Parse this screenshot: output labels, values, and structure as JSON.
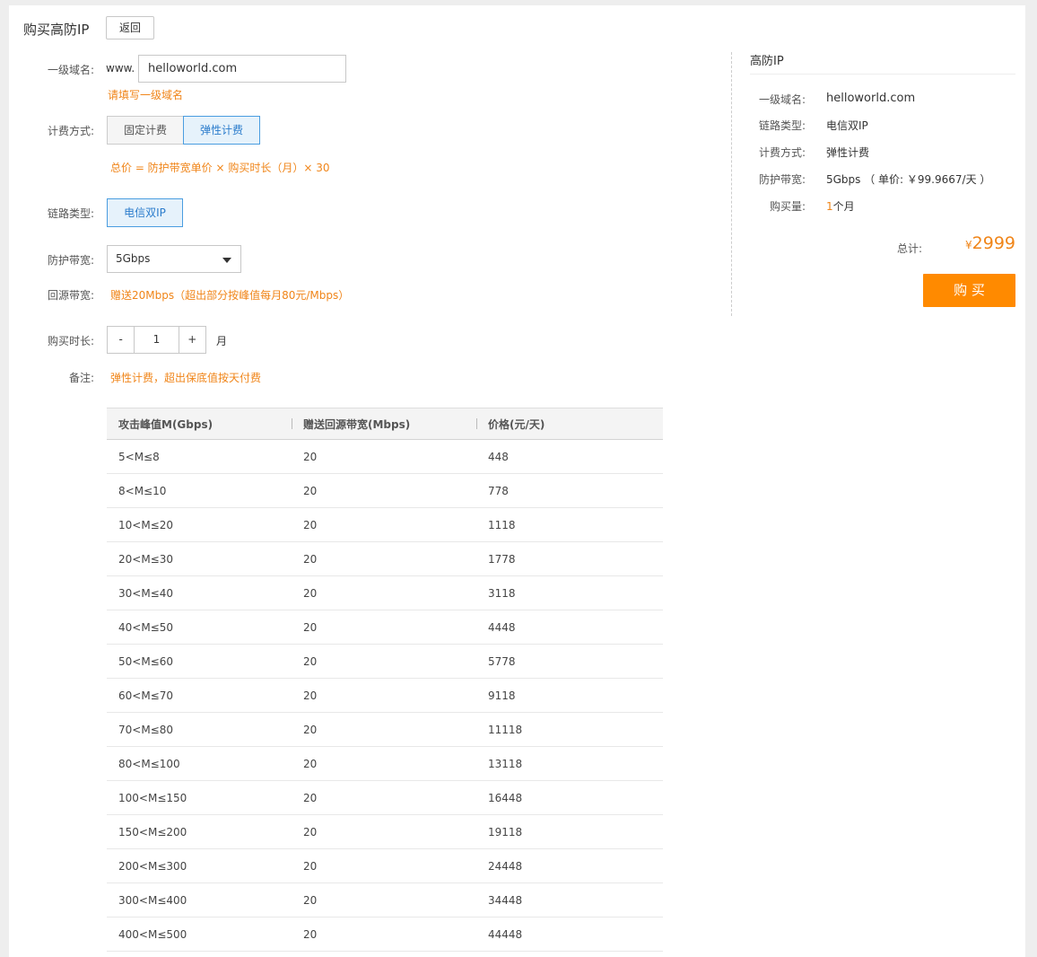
{
  "header": {
    "title": "购买高防IP",
    "back_label": "返回"
  },
  "form": {
    "domain": {
      "label": "一级域名:",
      "prefix": "www.",
      "value": "helloworld.com",
      "hint": "请填写一级域名"
    },
    "billing": {
      "label": "计费方式:",
      "options": [
        "固定计费",
        "弹性计费"
      ],
      "selected": "弹性计费",
      "formula": "总价 = 防护带宽单价 × 购买时长（月）× 30"
    },
    "line": {
      "label": "链路类型:",
      "options": [
        "电信双IP"
      ],
      "selected": "电信双IP"
    },
    "bandwidth": {
      "label": "防护带宽:",
      "selected": "5Gbps"
    },
    "origin_bandwidth": {
      "label": "回源带宽:",
      "text": "赠送20Mbps（超出部分按峰值每月80元/Mbps）"
    },
    "duration": {
      "label": "购买时长:",
      "minus": "-",
      "value": "1",
      "plus": "+",
      "unit": "月"
    },
    "note": {
      "label": "备注:",
      "text": "弹性计费，超出保底值按天付费"
    }
  },
  "price_table": {
    "headers": [
      "攻击峰值M(Gbps)",
      "赠送回源带宽(Mbps)",
      "价格(元/天)"
    ],
    "rows": [
      [
        "5<M≤8",
        "20",
        "448"
      ],
      [
        "8<M≤10",
        "20",
        "778"
      ],
      [
        "10<M≤20",
        "20",
        "1118"
      ],
      [
        "20<M≤30",
        "20",
        "1778"
      ],
      [
        "30<M≤40",
        "20",
        "3118"
      ],
      [
        "40<M≤50",
        "20",
        "4448"
      ],
      [
        "50<M≤60",
        "20",
        "5778"
      ],
      [
        "60<M≤70",
        "20",
        "9118"
      ],
      [
        "70<M≤80",
        "20",
        "11118"
      ],
      [
        "80<M≤100",
        "20",
        "13118"
      ],
      [
        "100<M≤150",
        "20",
        "16448"
      ],
      [
        "150<M≤200",
        "20",
        "19118"
      ],
      [
        "200<M≤300",
        "20",
        "24448"
      ],
      [
        "300<M≤400",
        "20",
        "34448"
      ],
      [
        "400<M≤500",
        "20",
        "44448"
      ]
    ]
  },
  "summary": {
    "title": "高防IP",
    "items": [
      {
        "label": "一级域名:",
        "value": "helloworld.com"
      },
      {
        "label": "链路类型:",
        "value": "电信双IP"
      },
      {
        "label": "计费方式:",
        "value": "弹性计费"
      },
      {
        "label": "防护带宽:",
        "value": "5Gbps （ 单价: ￥99.9667/天 ）"
      },
      {
        "label": "购买量:",
        "qty": "1",
        "unit": "个月"
      }
    ],
    "total_label": "总计:",
    "currency": "¥",
    "total": "2999",
    "buy_label": "购 买"
  },
  "colors": {
    "accent": "#f08519",
    "buy_button": "#ff8a00",
    "selected_blue": "#2b7ccc"
  }
}
